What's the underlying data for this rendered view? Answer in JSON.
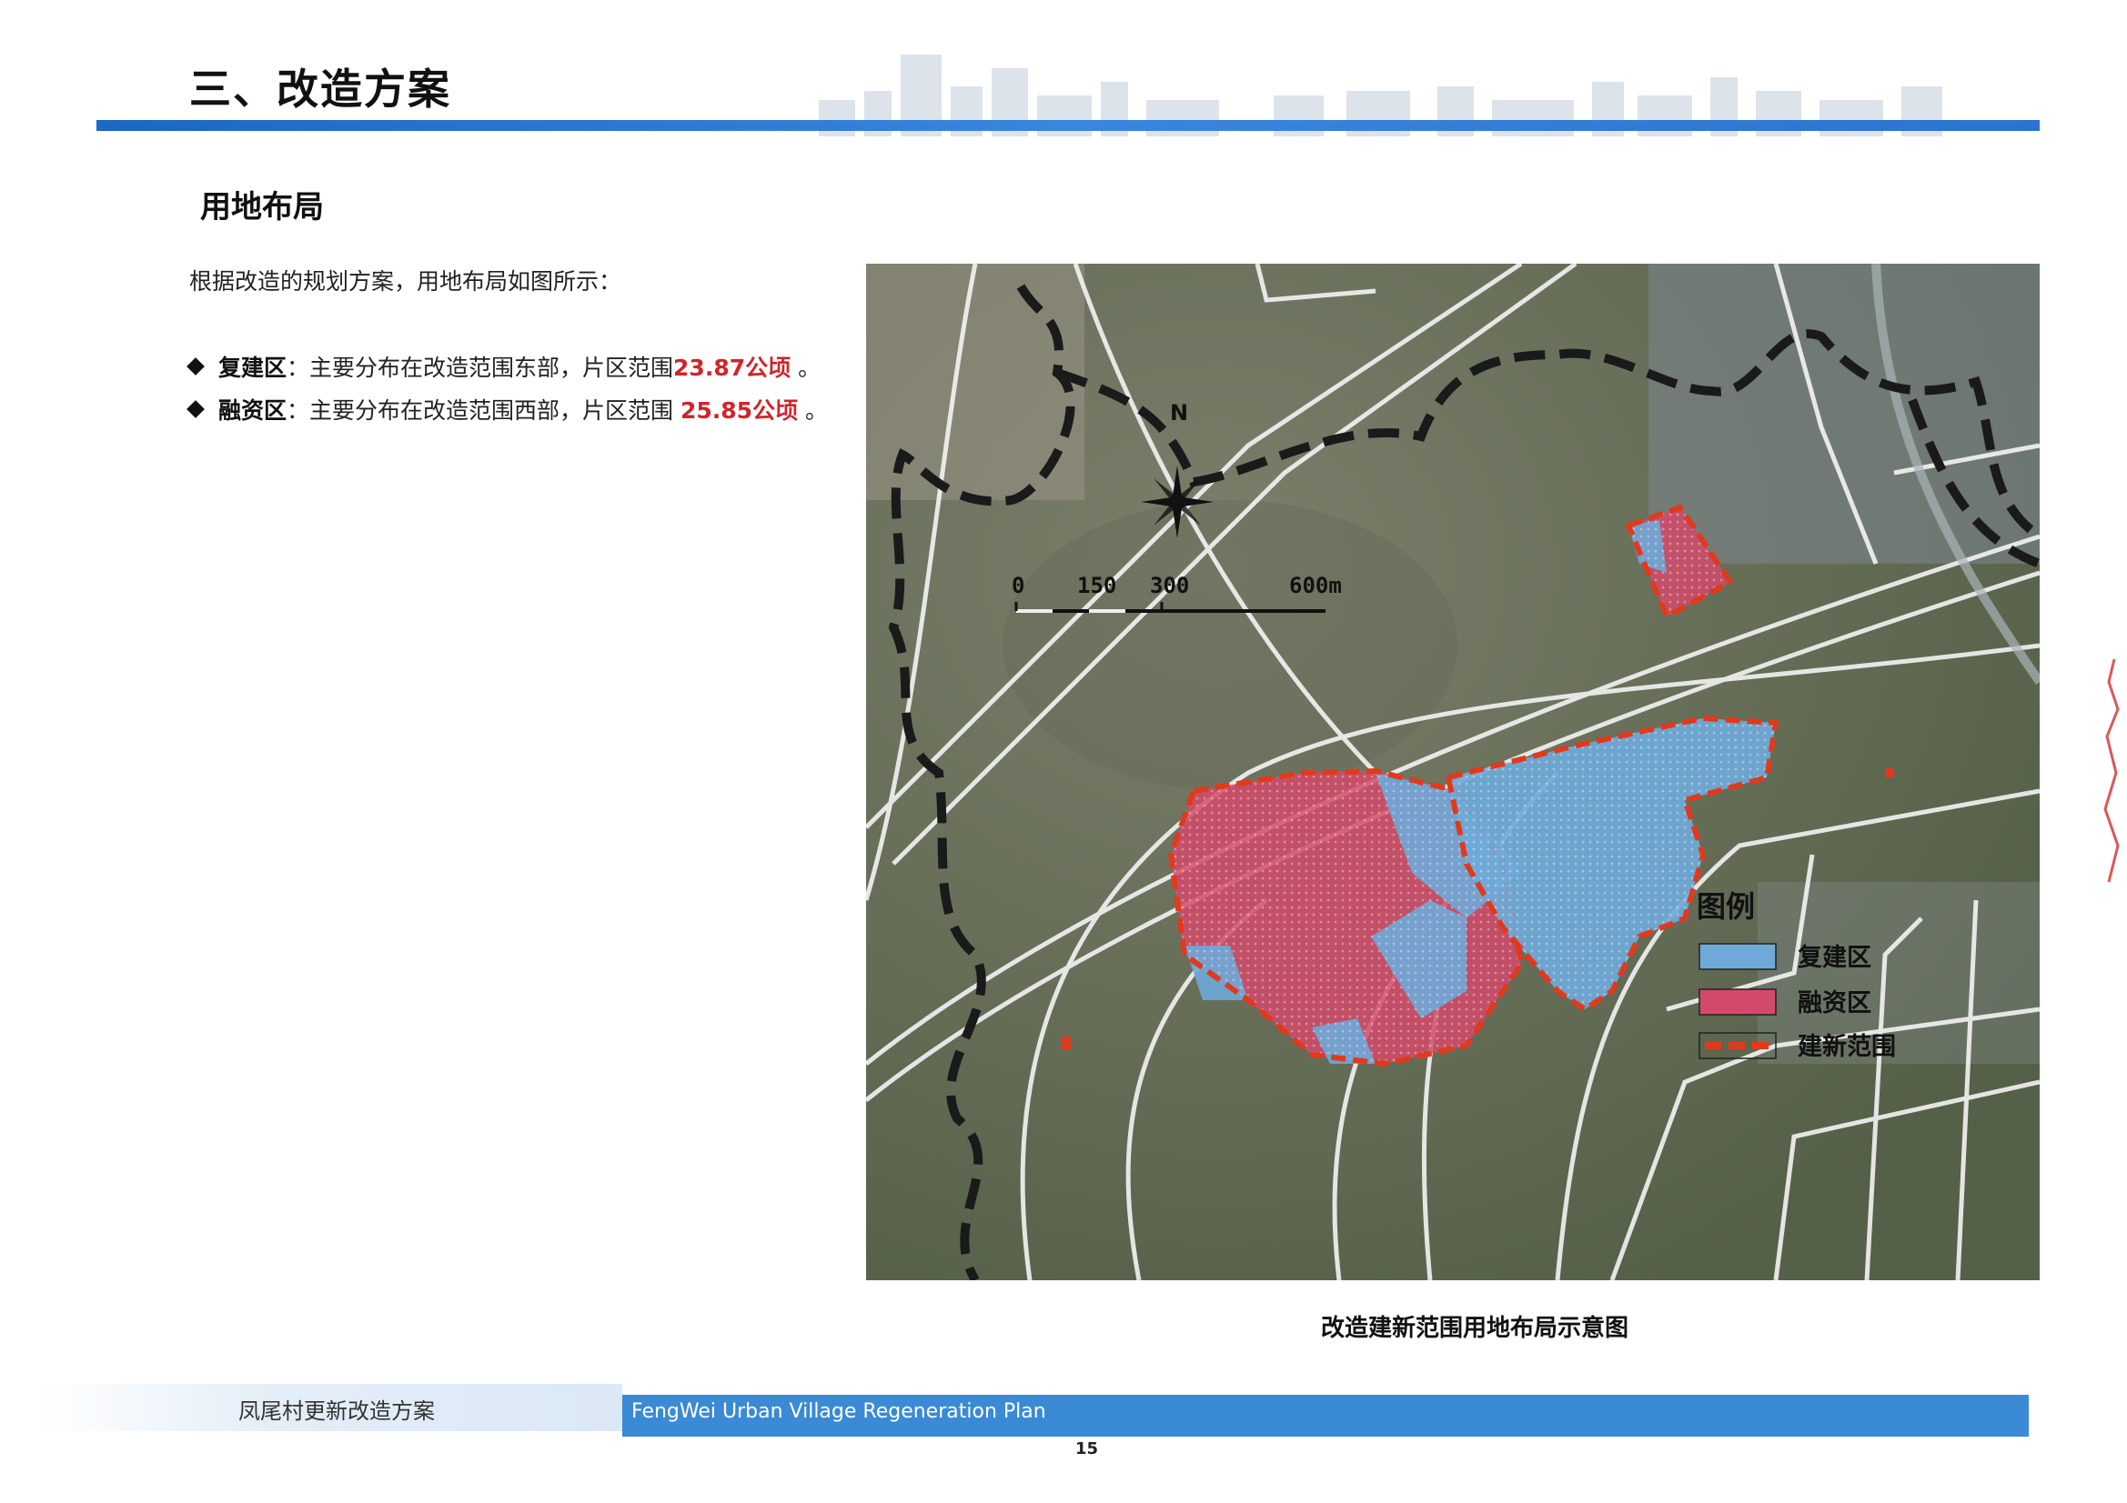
{
  "header": {
    "title": "三、改造方案"
  },
  "section": {
    "title": "用地布局",
    "intro": "根据改造的规划方案，用地布局如图所示："
  },
  "bullets": [
    {
      "term": "复建区",
      "text": "：主要分布在改造范围东部，片区范围",
      "value": "23.87公顷",
      "end": "。"
    },
    {
      "term": "融资区",
      "text": "：主要分布在改造范围西部，片区范围 ",
      "value": "25.85公顷",
      "end": "。"
    }
  ],
  "map": {
    "north_label": "N",
    "scale_labels": [
      "0",
      "150",
      "300",
      "600m"
    ],
    "legend": {
      "title": "图例",
      "items": [
        {
          "label": "复建区",
          "color": "#6fa9d8"
        },
        {
          "label": "融资区",
          "color": "#d24a6a"
        },
        {
          "label": "建新范围",
          "color": "#e03a1e"
        }
      ]
    },
    "caption": "改造建新范围用地布局示意图"
  },
  "footer": {
    "left_text": "凤尾村更新改造方案",
    "right_text": "FengWei Urban Village Regeneration Plan",
    "page_number": "15"
  },
  "colors": {
    "header_bar": "#1b67c4",
    "highlight": "#d2232a",
    "footer_bar": "#3a8ad6"
  }
}
